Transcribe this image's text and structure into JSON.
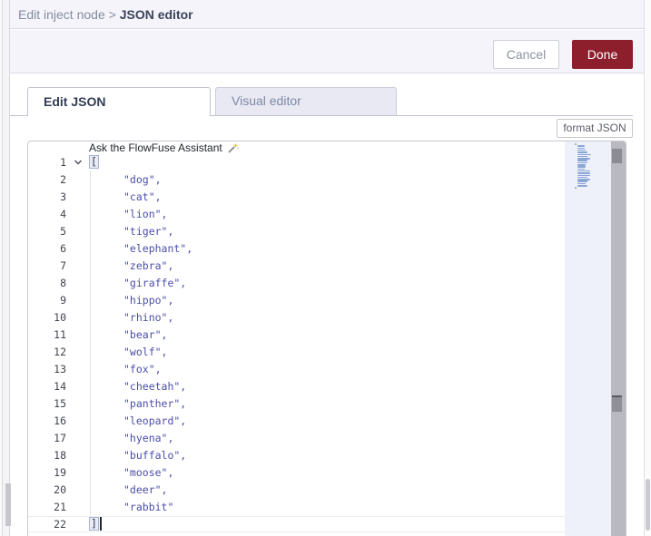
{
  "breadcrumb": {
    "parent": "Edit inject node",
    "separator": ">",
    "current": "JSON editor"
  },
  "header_buttons": {
    "cancel": "Cancel",
    "done": "Done"
  },
  "tabs": {
    "edit_json": "Edit JSON",
    "visual_editor": "Visual editor"
  },
  "toolbar": {
    "format_button": "format JSON"
  },
  "assistant": {
    "label": "Ask the FlowFuse Assistant"
  },
  "editor": {
    "line_count": 22,
    "lines": [
      {
        "number": 1,
        "text": "[",
        "kind": "open"
      },
      {
        "number": 2,
        "text": "\"dog\",",
        "kind": "string"
      },
      {
        "number": 3,
        "text": "\"cat\",",
        "kind": "string"
      },
      {
        "number": 4,
        "text": "\"lion\",",
        "kind": "string"
      },
      {
        "number": 5,
        "text": "\"tiger\",",
        "kind": "string"
      },
      {
        "number": 6,
        "text": "\"elephant\",",
        "kind": "string"
      },
      {
        "number": 7,
        "text": "\"zebra\",",
        "kind": "string"
      },
      {
        "number": 8,
        "text": "\"giraffe\",",
        "kind": "string"
      },
      {
        "number": 9,
        "text": "\"hippo\",",
        "kind": "string"
      },
      {
        "number": 10,
        "text": "\"rhino\",",
        "kind": "string"
      },
      {
        "number": 11,
        "text": "\"bear\",",
        "kind": "string"
      },
      {
        "number": 12,
        "text": "\"wolf\",",
        "kind": "string"
      },
      {
        "number": 13,
        "text": "\"fox\",",
        "kind": "string"
      },
      {
        "number": 14,
        "text": "\"cheetah\",",
        "kind": "string"
      },
      {
        "number": 15,
        "text": "\"panther\",",
        "kind": "string"
      },
      {
        "number": 16,
        "text": "\"leopard\",",
        "kind": "string"
      },
      {
        "number": 17,
        "text": "\"hyena\",",
        "kind": "string"
      },
      {
        "number": 18,
        "text": "\"buffalo\",",
        "kind": "string"
      },
      {
        "number": 19,
        "text": "\"moose\",",
        "kind": "string"
      },
      {
        "number": 20,
        "text": "\"deer\",",
        "kind": "string"
      },
      {
        "number": 21,
        "text": "\"rabbit\"",
        "kind": "string"
      },
      {
        "number": 22,
        "text": "]",
        "kind": "close",
        "cursor": true
      }
    ]
  },
  "icons": {
    "fold": "chevron-down-icon",
    "assistant": "magic-wand-icon"
  },
  "colors": {
    "accent_red": "#8d1f2d",
    "band_bg": "#f4f4fa",
    "string_blue": "#4b4ea8",
    "minimap_mark": "#8aa6d6",
    "minimap_bracket": "#9a9ab0"
  }
}
